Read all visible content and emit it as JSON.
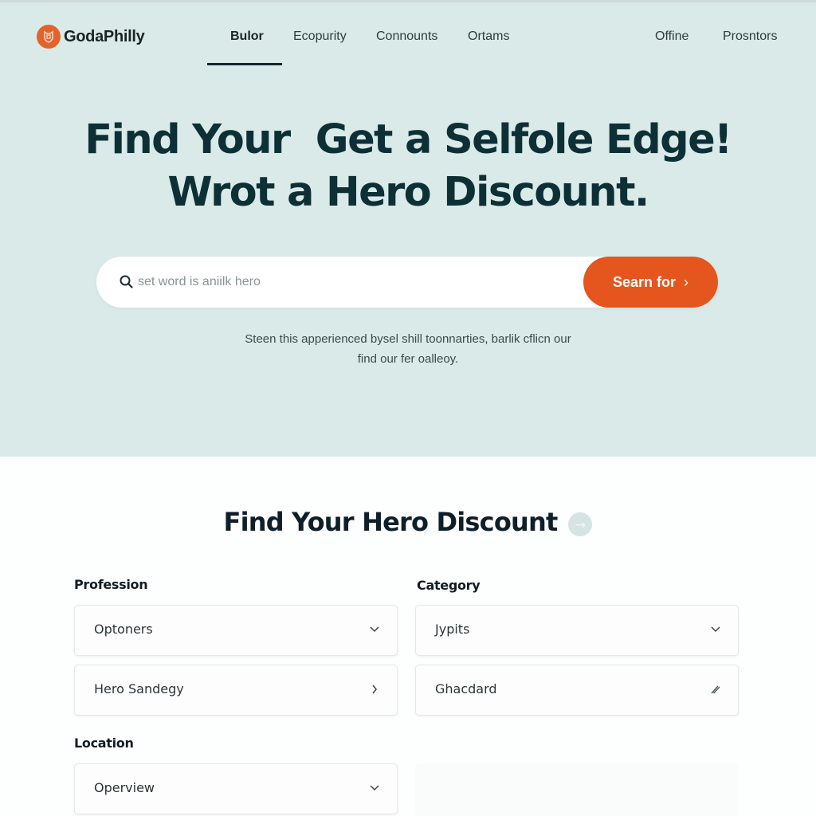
{
  "brand": {
    "name": "GodaPhilly",
    "logo_icon": "shield-badge-icon",
    "accent_color": "#e5561f"
  },
  "nav": {
    "items": [
      {
        "label": "Bulor",
        "active": true
      },
      {
        "label": "Ecopurity",
        "active": false
      },
      {
        "label": "Connounts",
        "active": false
      },
      {
        "label": "Ortams",
        "active": false
      }
    ],
    "right_items": [
      {
        "label": "Offine"
      },
      {
        "label": "Prosntors"
      }
    ]
  },
  "hero": {
    "headline_line1": "Find Your  Get a Selfole Edge!",
    "headline_line2": "Wrot a Hero Discount.",
    "search": {
      "icon": "search-icon",
      "placeholder": "set word is aniilk hero",
      "value": "",
      "button_label": "Searn for",
      "button_icon": "chevron-right-icon"
    },
    "subtext_line1": "Steen this apperienced bysel shill toonnarties, barlik cflicn our",
    "subtext_line2": "find our fer oalleoy.",
    "background_color": "#d9eae8"
  },
  "finder": {
    "title": "Find Your Hero Discount",
    "title_icon": "arrow-right-icon",
    "profession": {
      "label": "Profession",
      "select_value": "Optoners",
      "select_icon": "chevron-down-icon",
      "link_value": "Hero Sandegy",
      "link_icon": "chevron-right-icon"
    },
    "category": {
      "label": "Category",
      "select_value": "Jypits",
      "select_icon": "chevron-down-icon",
      "input_value": "Ghacdard",
      "input_icon": "pencil-icon"
    },
    "location": {
      "label": "Location",
      "select_value": "Operview",
      "select_icon": "chevron-down-icon"
    }
  }
}
